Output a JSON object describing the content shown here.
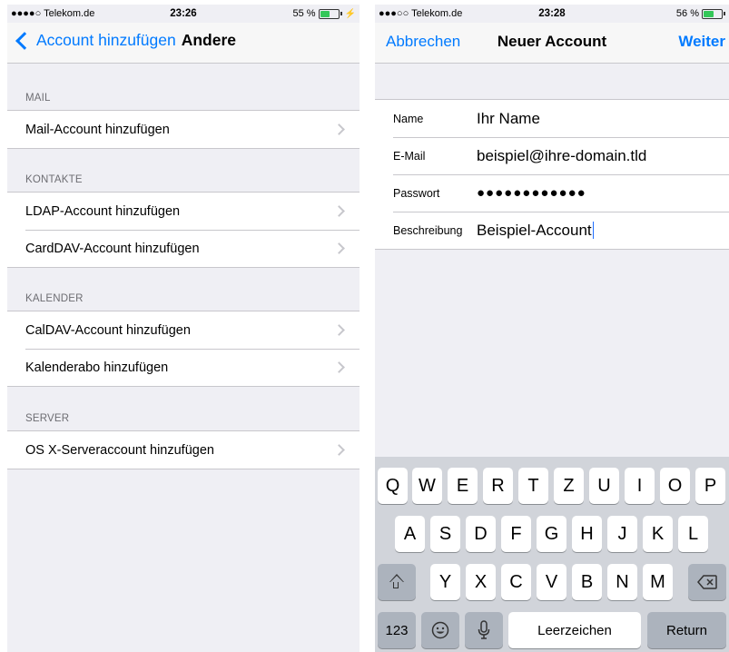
{
  "left": {
    "status": {
      "carrier": "●●●●○ Telekom.de",
      "time": "23:26",
      "battery_pct": "55 %",
      "battery_level": 0.55
    },
    "nav": {
      "back_label": "Account hinzufügen",
      "title": "Andere"
    },
    "sections": [
      {
        "header": "MAIL",
        "items": [
          "Mail-Account hinzufügen"
        ]
      },
      {
        "header": "KONTAKTE",
        "items": [
          "LDAP-Account hinzufügen",
          "CardDAV-Account hinzufügen"
        ]
      },
      {
        "header": "KALENDER",
        "items": [
          "CalDAV-Account hinzufügen",
          "Kalenderabo hinzufügen"
        ]
      },
      {
        "header": "SERVER",
        "items": [
          "OS X-Serveraccount hinzufügen"
        ]
      }
    ]
  },
  "right": {
    "status": {
      "carrier": "●●●○○ Telekom.de",
      "time": "23:28",
      "battery_pct": "56 %",
      "battery_level": 0.56
    },
    "nav": {
      "cancel": "Abbrechen",
      "title": "Neuer Account",
      "next": "Weiter"
    },
    "form": {
      "name_label": "Name",
      "name_value": "Ihr Name",
      "email_label": "E-Mail",
      "email_value": "beispiel@ihre-domain.tld",
      "password_label": "Passwort",
      "password_value": "●●●●●●●●●●●●",
      "description_label": "Beschreibung",
      "description_value": "Beispiel-Account"
    },
    "keyboard": {
      "row1": [
        "Q",
        "W",
        "E",
        "R",
        "T",
        "Z",
        "U",
        "I",
        "O",
        "P"
      ],
      "row2": [
        "A",
        "S",
        "D",
        "F",
        "G",
        "H",
        "J",
        "K",
        "L"
      ],
      "row3": [
        "Y",
        "X",
        "C",
        "V",
        "B",
        "N",
        "M"
      ],
      "numbers": "123",
      "space": "Leerzeichen",
      "return": "Return"
    }
  },
  "colors": {
    "accent": "#007aff",
    "background": "#efeff4",
    "battery": "#34c759"
  }
}
